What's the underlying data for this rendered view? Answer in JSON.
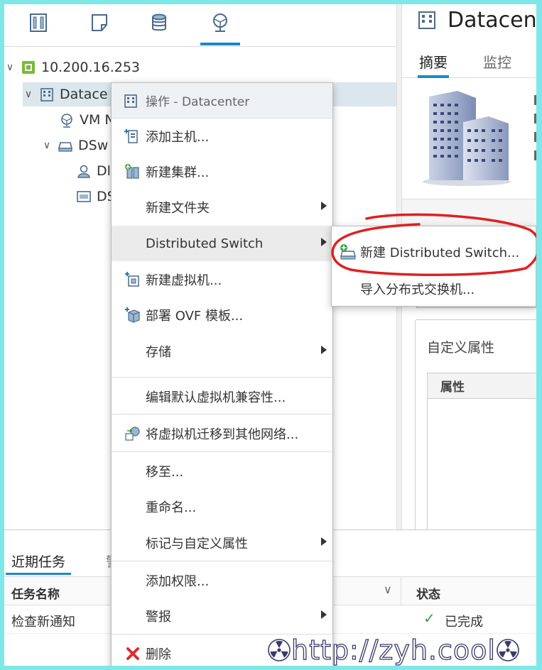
{
  "nav_tabs": [
    {
      "icon": "hosts-clusters-icon"
    },
    {
      "icon": "vms-templates-icon"
    },
    {
      "icon": "storage-icon"
    },
    {
      "icon": "networking-icon"
    }
  ],
  "tree": {
    "vcenter": "10.200.16.253",
    "datacenter": "Datace",
    "vm_network": "VM N",
    "dswitch": "DSw",
    "portgroup": "Dl",
    "uplinks": "DS"
  },
  "right_panel": {
    "title": "Datacen",
    "tabs": [
      "摘要",
      "监控"
    ],
    "custom_attrs_title": "自定义属性",
    "attr_col": "属性"
  },
  "context_menu": {
    "header": "操作 - Datacenter",
    "items": [
      {
        "label": "添加主机...",
        "icon": "add-host-icon",
        "submenu": false
      },
      {
        "label": "新建集群...",
        "icon": "new-cluster-icon",
        "submenu": false
      },
      {
        "label": "新建文件夹",
        "icon": "",
        "submenu": true
      },
      {
        "label": "Distributed Switch",
        "icon": "",
        "submenu": true
      },
      {
        "label": "新建虚拟机...",
        "icon": "new-vm-icon",
        "submenu": false
      },
      {
        "label": "部署 OVF 模板...",
        "icon": "deploy-ovf-icon",
        "submenu": false
      },
      {
        "label": "存储",
        "icon": "",
        "submenu": true
      },
      {
        "label": "编辑默认虚拟机兼容性...",
        "icon": "",
        "submenu": false
      },
      {
        "label": "将虚拟机迁移到其他网络...",
        "icon": "migrate-network-icon",
        "submenu": false
      },
      {
        "label": "移至...",
        "icon": "",
        "submenu": false
      },
      {
        "label": "重命名...",
        "icon": "",
        "submenu": false
      },
      {
        "label": "标记与自定义属性",
        "icon": "",
        "submenu": true
      },
      {
        "label": "添加权限...",
        "icon": "",
        "submenu": false
      },
      {
        "label": "警报",
        "icon": "",
        "submenu": true
      },
      {
        "label": "删除",
        "icon": "delete-icon",
        "submenu": false
      }
    ]
  },
  "submenu": {
    "items": [
      "新建 Distributed Switch...",
      "导入分布式交换机..."
    ]
  },
  "bottom": {
    "tabs": [
      "近期任务",
      "警"
    ],
    "columns": [
      "任务名称",
      "状态"
    ],
    "rows": [
      {
        "task": "检查新通知",
        "status": "已完成"
      }
    ]
  },
  "watermark": "http://zyh.cool",
  "colors": {
    "accent": "#1a8bc5",
    "highlight": "#ebebeb",
    "annotation_red": "#e02020",
    "success": "#3c9a3c",
    "frame": "#7ee8e8"
  }
}
